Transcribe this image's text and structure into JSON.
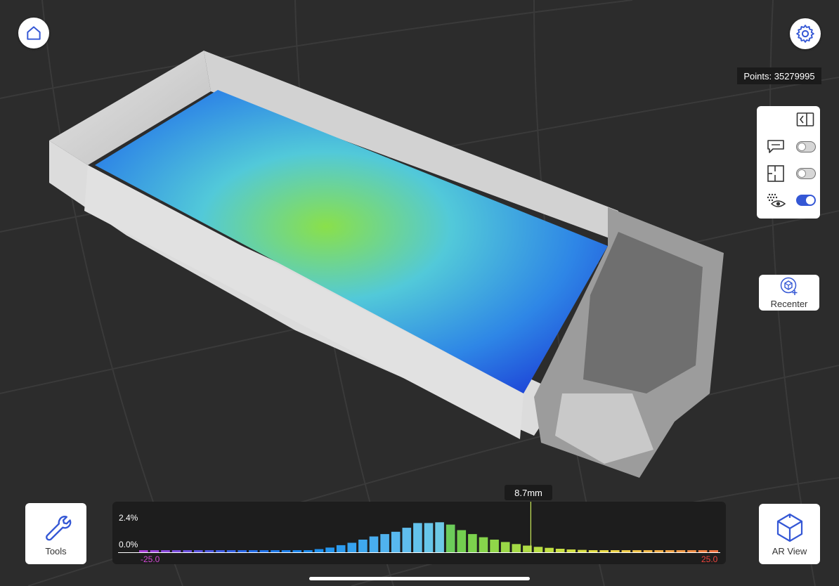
{
  "status": {
    "points_label": "Points: 35279995"
  },
  "panel": {
    "toggles": [
      {
        "name": "annotations",
        "on": false
      },
      {
        "name": "floor-plan",
        "on": false
      },
      {
        "name": "point-visibility",
        "on": true
      }
    ]
  },
  "recenter": {
    "label": "Recenter"
  },
  "tools": {
    "label": "Tools"
  },
  "ar_view": {
    "label": "AR View"
  },
  "histogram": {
    "marker_label": "8.7mm",
    "marker_value": 8.7,
    "y_top_label": "2.4%",
    "y_bottom_label": "0.0%",
    "x_min_label": "-25.0",
    "x_max_label": "25.0",
    "colors": {
      "accent": "#3457d5",
      "min_label": "#d548d8",
      "max_label": "#f0443c",
      "marker": "#c9e85a"
    }
  },
  "chart_data": {
    "type": "bar",
    "xlim": [
      -25.0,
      25.0
    ],
    "ylim": [
      0.0,
      2.4
    ],
    "values": [
      0.05,
      0.05,
      0.05,
      0.05,
      0.05,
      0.05,
      0.05,
      0.05,
      0.05,
      0.05,
      0.05,
      0.05,
      0.05,
      0.06,
      0.08,
      0.12,
      0.2,
      0.3,
      0.45,
      0.6,
      0.8,
      1.0,
      1.15,
      1.3,
      1.55,
      1.85,
      1.85,
      1.9,
      1.75,
      1.4,
      1.15,
      0.95,
      0.8,
      0.65,
      0.52,
      0.42,
      0.34,
      0.28,
      0.22,
      0.18,
      0.15,
      0.12,
      0.1,
      0.09,
      0.08,
      0.07,
      0.06,
      0.06,
      0.05,
      0.05,
      0.05,
      0.05,
      0.05
    ],
    "colors": [
      "#a93fd8",
      "#9a44db",
      "#8a49de",
      "#7b4ee0",
      "#6c52e2",
      "#5c56e4",
      "#4e5be6",
      "#405fe8",
      "#3564e9",
      "#2a69ea",
      "#246feb",
      "#2174ec",
      "#1e7aec",
      "#1c80ed",
      "#1b86ee",
      "#1b8bee",
      "#1e91ef",
      "#2597ef",
      "#2d9cef",
      "#36a2ef",
      "#3fa8ee",
      "#48adee",
      "#50b2ee",
      "#58b8ee",
      "#5fbdee",
      "#63c2ec",
      "#67c6ea",
      "#6dc9e6",
      "#6ccc5a",
      "#73cf4f",
      "#7cd24d",
      "#86d44b",
      "#90d649",
      "#9ad847",
      "#a4da46",
      "#aedc45",
      "#b7de44",
      "#c0df44",
      "#c9e044",
      "#d2e045",
      "#dae046",
      "#e2de47",
      "#e8da48",
      "#edd449",
      "#f0cd4a",
      "#f2c54b",
      "#f3bc4b",
      "#f4b24b",
      "#f4a74a",
      "#f39b48",
      "#f28f46",
      "#f18244",
      "#f07442"
    ]
  }
}
